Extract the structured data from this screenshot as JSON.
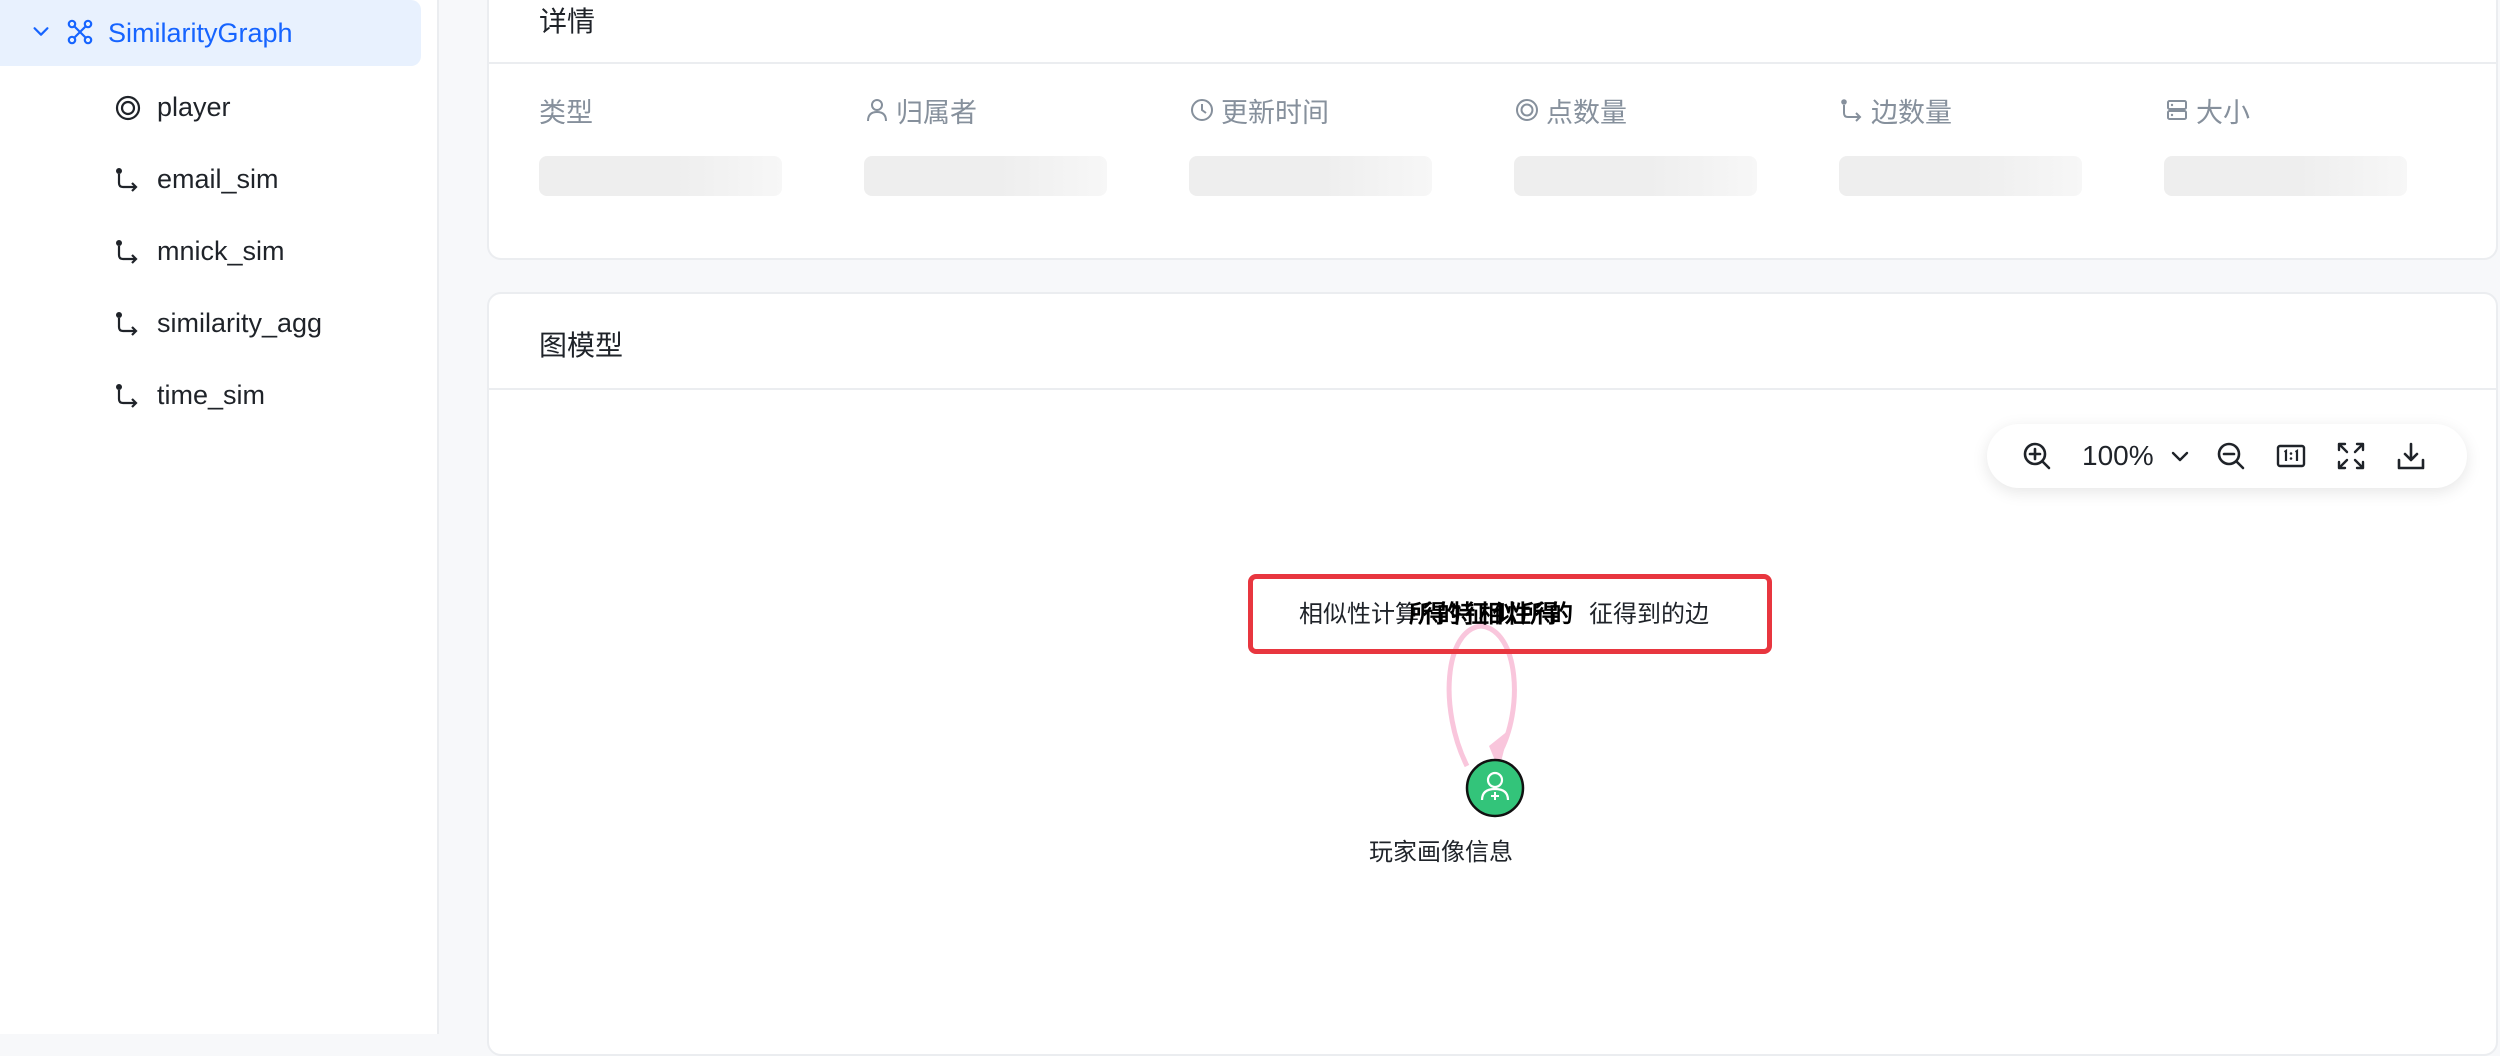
{
  "sidebar": {
    "root": {
      "label": "SimilarityGraph",
      "icon": "graph-icon",
      "expanded": true
    },
    "items": [
      {
        "label": "player",
        "icon": "vertex-icon"
      },
      {
        "label": "email_sim",
        "icon": "edge-icon"
      },
      {
        "label": "mnick_sim",
        "icon": "edge-icon"
      },
      {
        "label": "similarity_agg",
        "icon": "edge-icon"
      },
      {
        "label": "time_sim",
        "icon": "edge-icon"
      }
    ]
  },
  "details": {
    "title": "详情",
    "fields": [
      {
        "label": "类型",
        "icon": ""
      },
      {
        "label": "归属者",
        "icon": "user-icon"
      },
      {
        "label": "更新时间",
        "icon": "clock-icon"
      },
      {
        "label": "点数量",
        "icon": "vertex-icon"
      },
      {
        "label": "边数量",
        "icon": "edge-icon"
      },
      {
        "label": "大小",
        "icon": "storage-icon"
      }
    ]
  },
  "graph_model": {
    "title": "图模型",
    "toolbar": {
      "zoom_level": "100%",
      "buttons": [
        "zoom-in-icon",
        "zoom-out-icon",
        "actual-size-icon",
        "fit-screen-icon",
        "download-icon"
      ]
    },
    "edge_label_visible": "相似性计算",
    "edge_label_overlap": "所得的特征相似性所得的",
    "edge_label_tail": "征得到的边",
    "node_label": "玩家画像信息"
  },
  "colors": {
    "accent": "#1664ff",
    "selected_bg": "#e8f1fe",
    "node": "#33c47a",
    "edge": "#f9c6dc",
    "highlight": "#e8363f"
  }
}
